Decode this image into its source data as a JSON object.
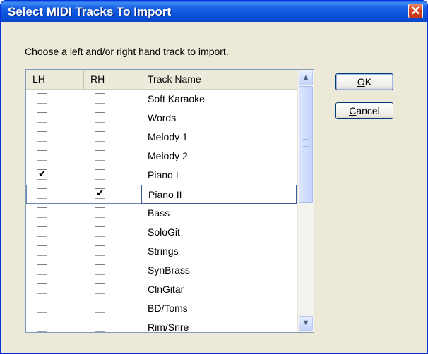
{
  "dialog": {
    "title": "Select MIDI Tracks To Import",
    "close_glyph": "✕"
  },
  "instruction": "Choose a left and/or right hand track to import.",
  "columns": [
    "LH",
    "RH",
    "Track Name"
  ],
  "tracks": [
    {
      "name": "Soft Karaoke",
      "lh": false,
      "rh": false
    },
    {
      "name": "Words",
      "lh": false,
      "rh": false
    },
    {
      "name": "Melody 1",
      "lh": false,
      "rh": false
    },
    {
      "name": "Melody 2",
      "lh": false,
      "rh": false
    },
    {
      "name": "Piano I",
      "lh": true,
      "rh": false
    },
    {
      "name": "Piano II",
      "lh": false,
      "rh": true,
      "selected": true
    },
    {
      "name": "Bass",
      "lh": false,
      "rh": false
    },
    {
      "name": "SoloGit",
      "lh": false,
      "rh": false
    },
    {
      "name": "Strings",
      "lh": false,
      "rh": false
    },
    {
      "name": "SynBrass",
      "lh": false,
      "rh": false
    },
    {
      "name": "ClnGitar",
      "lh": false,
      "rh": false
    },
    {
      "name": "BD/Toms",
      "lh": false,
      "rh": false
    },
    {
      "name": "Rim/Snre",
      "lh": false,
      "rh": false
    }
  ],
  "buttons": {
    "ok_label": "OK",
    "ok_mnemonic": "O",
    "ok_rest": "K",
    "cancel_label": "Cancel",
    "cancel_mnemonic": "C",
    "cancel_rest": "ancel"
  },
  "icons": {
    "close": "close-icon",
    "scroll_up": "chevron-up-icon",
    "scroll_down": "chevron-down-icon",
    "checkmark": "checkmark-icon"
  },
  "colors": {
    "titlebar": "#0a4fd8",
    "close_button": "#d9431f",
    "dialog_face": "#ece9d8",
    "list_border": "#7f9db9"
  }
}
